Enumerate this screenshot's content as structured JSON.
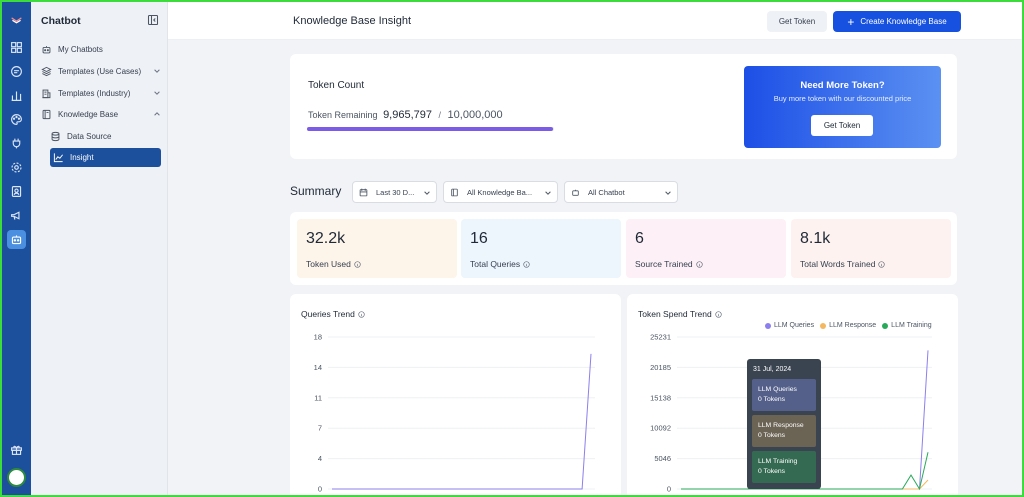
{
  "colors": {
    "rail": "#1c4f9c",
    "primary": "#1751e0",
    "progress": "#7b5ce6",
    "llm_queries": "#8b7ff0",
    "llm_response": "#f4b860",
    "llm_training": "#27a95a"
  },
  "rail": {
    "icons": [
      "logo-icon",
      "dashboard-icon",
      "chat-icon",
      "bar-chart-icon",
      "palette-icon",
      "plug-icon",
      "settings-icon",
      "contacts-icon",
      "megaphone-icon",
      "bot-icon",
      "gift-icon"
    ],
    "active": "bot-icon"
  },
  "sidebar": {
    "title": "Chatbot",
    "items": [
      {
        "label": "My Chatbots",
        "icon": "bot-icon"
      },
      {
        "label": "Templates (Use Cases)",
        "icon": "layers-icon",
        "chevron": "down"
      },
      {
        "label": "Templates (Industry)",
        "icon": "building-icon",
        "chevron": "down"
      },
      {
        "label": "Knowledge Base",
        "icon": "book-icon",
        "chevron": "up"
      },
      {
        "label": "Data Source",
        "icon": "database-icon"
      },
      {
        "label": "Insight",
        "icon": "trend-icon",
        "active": true
      }
    ]
  },
  "header": {
    "title": "Knowledge Base Insight",
    "get_token": "Get Token",
    "create": "Create Knowledge Base"
  },
  "token": {
    "title": "Token Count",
    "remaining_label": "Token Remaining",
    "remaining": "9,965,797",
    "separator": "/",
    "total": "10,000,000",
    "fraction_remaining": 0.9966,
    "promo_title": "Need More Token?",
    "promo_subtitle": "Buy more token with our discounted price",
    "promo_button": "Get Token"
  },
  "summary": {
    "title": "Summary",
    "filters": [
      {
        "label": "Last 30 D...",
        "icon": "calendar-icon"
      },
      {
        "label": "All Knowledge Ba...",
        "icon": "book-icon"
      },
      {
        "label": "All Chatbot",
        "icon": "bot-icon"
      }
    ],
    "stats": [
      {
        "value": "32.2k",
        "label": "Token Used",
        "bg": "#fdf4ea"
      },
      {
        "value": "16",
        "label": "Total Queries",
        "bg": "#edf5fd"
      },
      {
        "value": "6",
        "label": "Source Trained",
        "bg": "#fdf0f6"
      },
      {
        "value": "8.1k",
        "label": "Total Words Trained",
        "bg": "#fdf2ef"
      }
    ]
  },
  "chart_data": [
    {
      "type": "line",
      "title": "Queries Trend",
      "ylim": [
        0,
        18
      ],
      "yticks": [
        "18",
        "14",
        "11",
        "7",
        "4",
        "0"
      ],
      "series": [
        {
          "values": [
            0,
            0,
            0,
            0,
            0,
            0,
            0,
            0,
            0,
            0,
            0,
            0,
            0,
            0,
            0,
            0,
            0,
            0,
            0,
            0,
            0,
            0,
            0,
            0,
            0,
            0,
            0,
            0,
            0,
            16
          ]
        }
      ]
    },
    {
      "type": "line",
      "title": "Token Spend Trend",
      "ylim": [
        0,
        25231
      ],
      "yticks": [
        "25231",
        "20185",
        "15138",
        "10092",
        "5046",
        "0"
      ],
      "legend": "top-right",
      "series": [
        {
          "name": "LLM Queries",
          "values": [
            0,
            0,
            0,
            0,
            0,
            0,
            0,
            0,
            0,
            0,
            0,
            0,
            0,
            0,
            0,
            0,
            0,
            0,
            0,
            0,
            0,
            0,
            0,
            0,
            0,
            0,
            0,
            0,
            0,
            23000
          ]
        },
        {
          "name": "LLM Response",
          "values": [
            0,
            0,
            0,
            0,
            0,
            0,
            0,
            0,
            0,
            0,
            0,
            0,
            0,
            0,
            0,
            0,
            0,
            0,
            0,
            0,
            0,
            0,
            0,
            0,
            0,
            0,
            0,
            0,
            0,
            1500
          ]
        },
        {
          "name": "LLM Training",
          "values": [
            0,
            0,
            0,
            0,
            0,
            0,
            0,
            0,
            0,
            0,
            0,
            0,
            0,
            0,
            0,
            0,
            0,
            0,
            0,
            0,
            0,
            0,
            0,
            0,
            0,
            0,
            0,
            2300,
            0,
            6100
          ]
        }
      ],
      "tooltip": {
        "date": "31 Jul, 2024",
        "entries": [
          {
            "label": "LLM Queries",
            "value": "0 Tokens"
          },
          {
            "label": "LLM Response",
            "value": "0 Tokens"
          },
          {
            "label": "LLM Training",
            "value": "0 Tokens"
          }
        ]
      }
    }
  ]
}
